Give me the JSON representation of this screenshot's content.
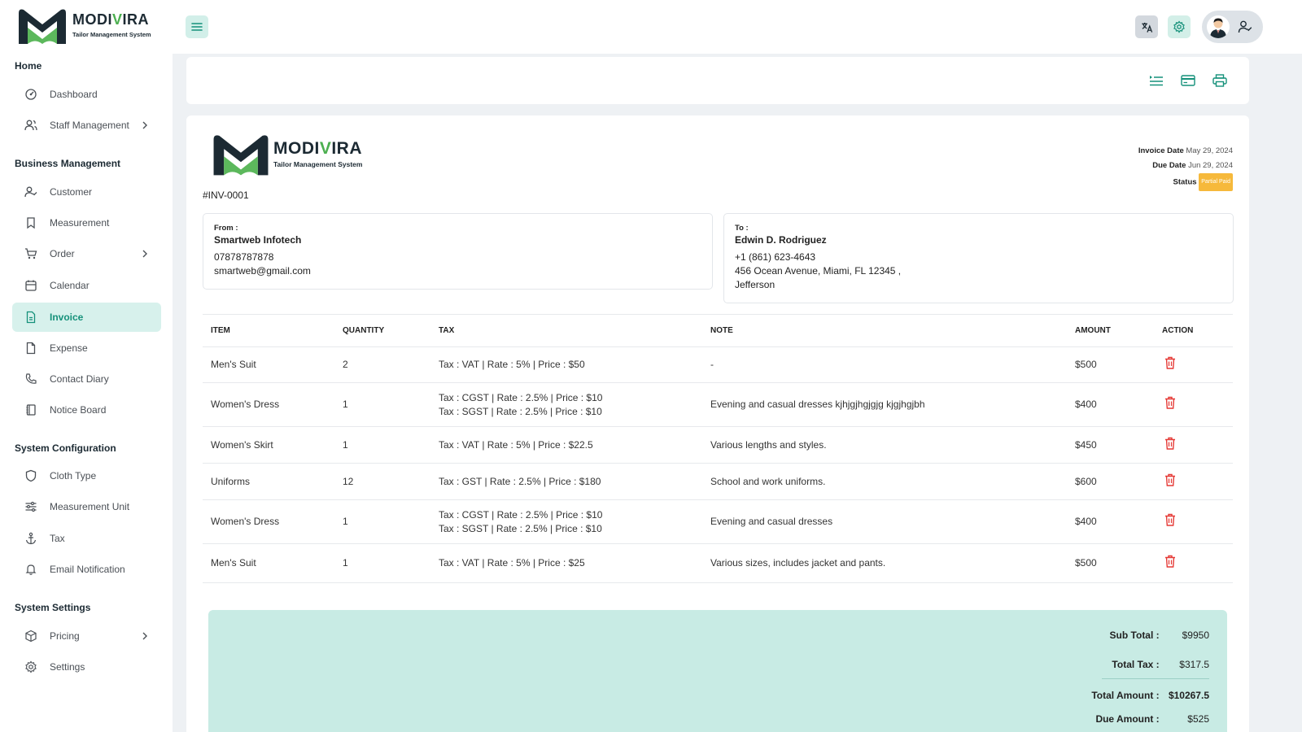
{
  "brand": {
    "name_prefix": "MODI",
    "name_v": "V",
    "name_suffix": "IRA",
    "tagline": "Tailor Management System"
  },
  "sidebar": {
    "sections": [
      {
        "title": "Home"
      },
      {
        "title": "Business Management"
      },
      {
        "title": "System Configuration"
      },
      {
        "title": "System Settings"
      }
    ],
    "items": [
      {
        "label": "Dashboard",
        "icon": "dashboard-icon"
      },
      {
        "label": "Staff Management",
        "icon": "users-icon",
        "has_submenu": true
      },
      {
        "label": "Customer",
        "icon": "user-check-icon"
      },
      {
        "label": "Measurement",
        "icon": "bookmark-icon"
      },
      {
        "label": "Order",
        "icon": "cart-icon",
        "has_submenu": true
      },
      {
        "label": "Calendar",
        "icon": "calendar-icon"
      },
      {
        "label": "Invoice",
        "icon": "file-icon",
        "active": true
      },
      {
        "label": "Expense",
        "icon": "file-icon"
      },
      {
        "label": "Contact Diary",
        "icon": "phone-icon"
      },
      {
        "label": "Notice Board",
        "icon": "notebook-icon"
      },
      {
        "label": "Cloth Type",
        "icon": "shield-icon"
      },
      {
        "label": "Measurement Unit",
        "icon": "sliders-icon"
      },
      {
        "label": "Tax",
        "icon": "anchor-icon"
      },
      {
        "label": "Email Notification",
        "icon": "bell-icon"
      },
      {
        "label": "Pricing",
        "icon": "box-icon",
        "has_submenu": true
      },
      {
        "label": "Settings",
        "icon": "gear-icon"
      }
    ]
  },
  "invoice": {
    "number": "#INV-0001",
    "invoice_date_label": "Invoice Date",
    "invoice_date": "May 29, 2024",
    "due_date_label": "Due Date",
    "due_date": "Jun 29, 2024",
    "status_label": "Status",
    "status": "Partial Paid",
    "from": {
      "label": "From :",
      "name": "Smartweb Infotech",
      "phone": "07878787878",
      "email": "smartweb@gmail.com"
    },
    "to": {
      "label": "To :",
      "name": "Edwin D. Rodriguez",
      "phone": "+1 (861) 623-4643",
      "address": "456 Ocean Avenue, Miami, FL 12345 ,",
      "city": "Jefferson"
    },
    "columns": [
      "ITEM",
      "QUANTITY",
      "TAX",
      "NOTE",
      "AMOUNT",
      "ACTION"
    ],
    "rows": [
      {
        "item": "Men's Suit",
        "qty": "2",
        "tax": [
          "Tax : VAT | Rate : 5% | Price : $50"
        ],
        "note": "-",
        "amount": "$500"
      },
      {
        "item": "Women's Dress",
        "qty": "1",
        "tax": [
          "Tax : CGST | Rate : 2.5% | Price : $10",
          "Tax : SGST | Rate : 2.5% | Price : $10"
        ],
        "note": "Evening and casual dresses kjhjgjhgjgjg kjgjhgjbh",
        "amount": "$400"
      },
      {
        "item": "Women's Skirt",
        "qty": "1",
        "tax": [
          "Tax : VAT | Rate : 5% | Price : $22.5"
        ],
        "note": "Various lengths and styles.",
        "amount": "$450"
      },
      {
        "item": "Uniforms",
        "qty": "12",
        "tax": [
          "Tax : GST | Rate : 2.5% | Price : $180"
        ],
        "note": "School and work uniforms.",
        "amount": "$600"
      },
      {
        "item": "Women's Dress",
        "qty": "1",
        "tax": [
          "Tax : CGST | Rate : 2.5% | Price : $10",
          "Tax : SGST | Rate : 2.5% | Price : $10"
        ],
        "note": "Evening and casual dresses",
        "amount": "$400"
      },
      {
        "item": "Men's Suit",
        "qty": "1",
        "tax": [
          "Tax : VAT | Rate : 5% | Price : $25"
        ],
        "note": "Various sizes, includes jacket and pants.",
        "amount": "$500"
      }
    ],
    "totals": {
      "sub_total_label": "Sub Total :",
      "sub_total": "$9950",
      "total_tax_label": "Total Tax :",
      "total_tax": "$317.5",
      "total_amount_label": "Total Amount :",
      "total_amount": "$10267.5",
      "due_amount_label": "Due Amount :",
      "due_amount": "$525"
    }
  },
  "colors": {
    "accent": "#15917a",
    "active_bg": "#d7f1ec",
    "totals_bg": "#c8ebe4",
    "danger": "#e53935",
    "status_badge": "#f6b93b"
  }
}
